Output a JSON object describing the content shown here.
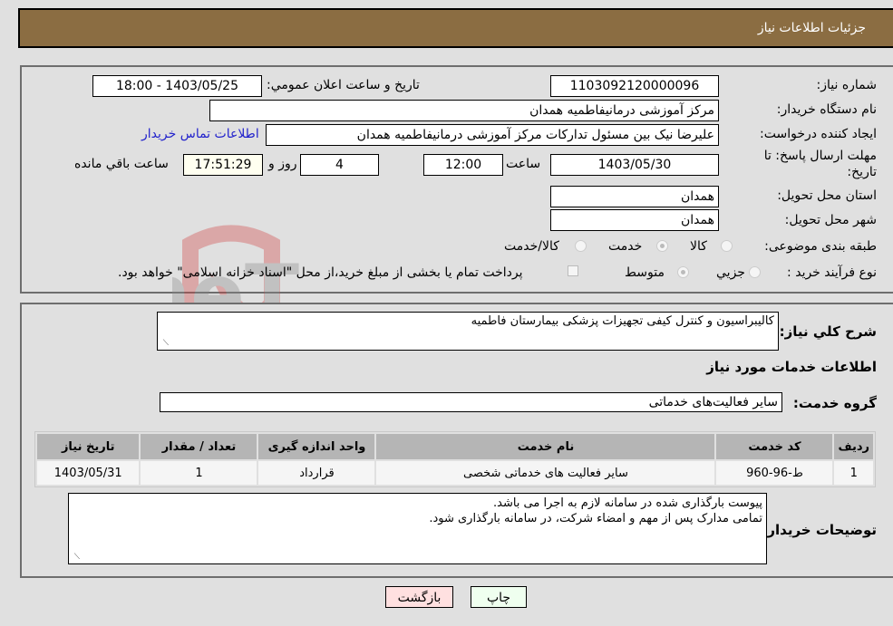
{
  "header": {
    "title": "جزئیات اطلاعات نیاز"
  },
  "form": {
    "need_number": {
      "label": "شماره نیاز:",
      "value": "1103092120000096"
    },
    "announce_datetime": {
      "label": "تاريخ و ساعت اعلان عمومي:",
      "value": "1403/05/25 - 18:00"
    },
    "buyer_org": {
      "label": "نام دستگاه خريدار:",
      "value": "مرکز آموزشی درمانیفاطمیه همدان"
    },
    "requester": {
      "label": "ايجاد کننده درخواست:",
      "value": "علیرضا نیک بین مسئول تدارکات مرکز آموزشی درمانیفاطمیه همدان"
    },
    "contact_link": "اطلاعات تماس خريدار",
    "deadline": {
      "label": "مهلت ارسال پاسخ: تا تاریخ:",
      "date": "1403/05/30",
      "time_label": "ساعت",
      "time": "12:00",
      "days": "4",
      "days_label": "روز و",
      "remaining": "17:51:29",
      "remaining_label": "ساعت باقي مانده"
    },
    "province": {
      "label": "استان محل تحويل:",
      "value": "همدان"
    },
    "city": {
      "label": "شهر محل تحويل:",
      "value": "همدان"
    },
    "category": {
      "label": "طبقه بندی موضوعی:",
      "options": [
        {
          "label": "کالا",
          "checked": false
        },
        {
          "label": "خدمت",
          "checked": true
        },
        {
          "label": "کالا/خدمت",
          "checked": false
        }
      ]
    },
    "purchase_type": {
      "label": "نوع فرآيند خريد :",
      "options": [
        {
          "label": "جزيي",
          "checked": false
        },
        {
          "label": "متوسط",
          "checked": true
        }
      ],
      "treasury_checkbox_label": "پرداخت تمام يا بخشی از مبلغ خريد،از محل \"اسناد خزانه اسلامی\" خواهد بود."
    }
  },
  "details": {
    "description_label": "شرح کلي نياز:",
    "description": "کالیبراسیون و کنترل کیفی تجهیزات پزشکی بیمارستان فاطمیه",
    "services_heading": "اطلاعات خدمات مورد نياز",
    "service_group_label": "گروه خدمت:",
    "service_group": "سایر فعالیت‌های خدماتی",
    "table": {
      "headers": [
        "رديف",
        "کد خدمت",
        "نام خدمت",
        "واحد اندازه گيری",
        "تعداد / مقدار",
        "تاريخ نياز"
      ],
      "rows": [
        [
          "1",
          "ط-96-960",
          "سایر فعالیت های خدماتی شخصی",
          "قرارداد",
          "1",
          "1403/05/31"
        ]
      ]
    },
    "buyer_notes_label": "توضيحات خريدار:",
    "buyer_notes": "پیوست بارگذاری شده در سامانه لازم به اجرا می باشد.\nتمامی مدارک پس از مهم و امضاء شرکت، در سامانه بارگذاری شود."
  },
  "buttons": {
    "print": "چاپ",
    "back": "بازگشت"
  },
  "watermark": {
    "text": "AriaTender.neT"
  }
}
